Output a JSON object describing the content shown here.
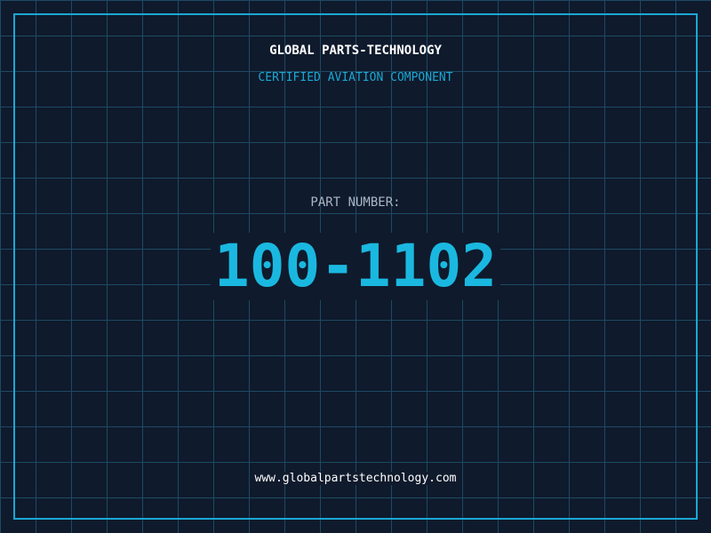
{
  "label": {
    "company": "GLOBAL PARTS-TECHNOLOGY",
    "subtitle": "CERTIFIED AVIATION COMPONENT",
    "part_number_label": "PART NUMBER:",
    "part_number": "100-1102",
    "website": "www.globalpartstechnology.com"
  },
  "colors": {
    "background": "#0f1a2c",
    "grid": "#1d4a63",
    "accent": "#1aa8d4",
    "text_primary": "#ffffff",
    "text_muted": "#aab7c6"
  }
}
